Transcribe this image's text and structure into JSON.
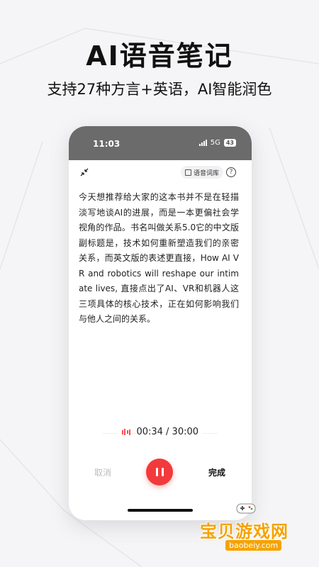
{
  "promo": {
    "headline": "AI语音笔记",
    "subheadline": "支持27种方言+英语，AI智能润色"
  },
  "status_bar": {
    "time": "11:03",
    "network": "5G",
    "battery": "43"
  },
  "toolbar": {
    "collapse_icon": "collapse-arrows-icon",
    "voice_library_label": "语音词库",
    "help_label": "?"
  },
  "note": {
    "text": "今天想推荐给大家的这本书并不是在轻描淡写地谈AI的进展，而是一本更偏社会学视角的作品。书名叫做关系5.0它的中文版副标题是，技术如何重新塑造我们的亲密关系，而英文版的表述更直接，How AI VR and robotics will reshape our intimate lives, 直接点出了AI、VR和机器人这三项具体的核心技术，正在如何影响我们与他人之间的关系。"
  },
  "recorder": {
    "elapsed": "00:34 / 30:00",
    "cancel_label": "取消",
    "done_label": "完成",
    "pause_icon": "pause-icon"
  },
  "watermark": {
    "text": "宝贝游戏网",
    "url": "baobeiy.com"
  },
  "colors": {
    "accent": "#f23a3c",
    "watermark": "#f5a300"
  }
}
